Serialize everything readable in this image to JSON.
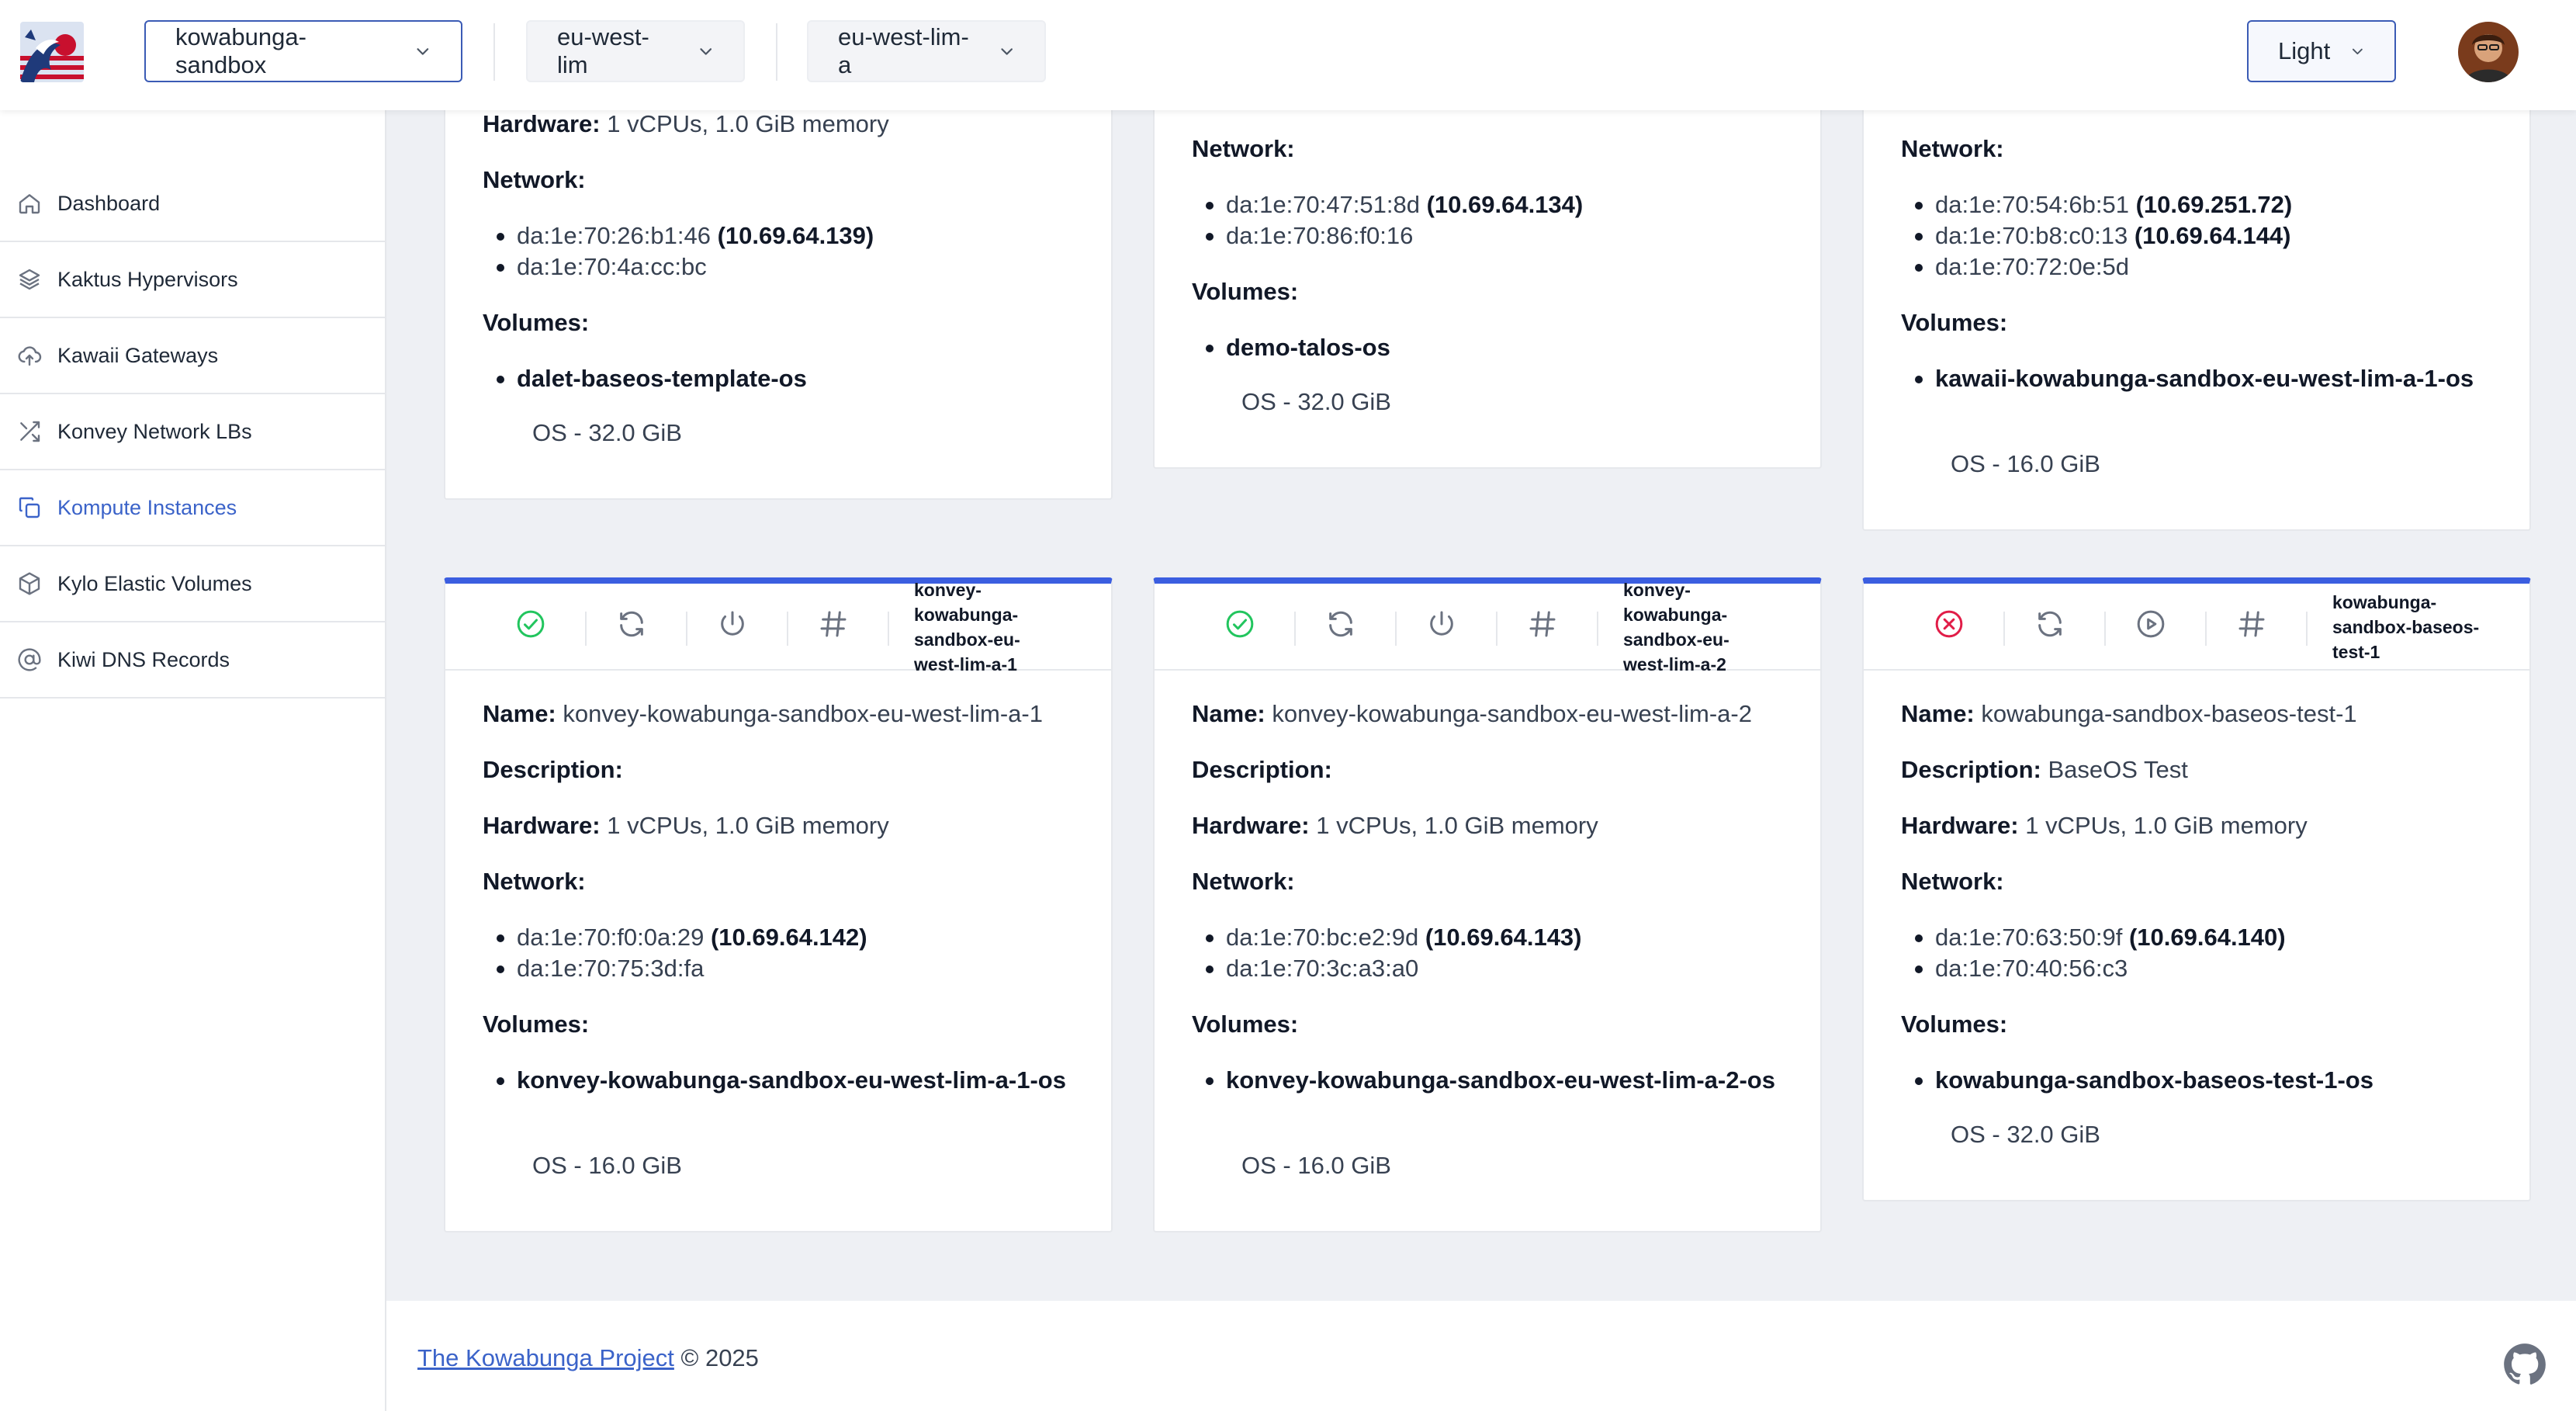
{
  "header": {
    "cloud": "kowabunga-sandbox",
    "region": "eu-west-lim",
    "zone": "eu-west-lim-a",
    "theme": "Light"
  },
  "sidebar": {
    "items": [
      {
        "label": "Dashboard",
        "icon": "home-icon"
      },
      {
        "label": "Kaktus Hypervisors",
        "icon": "layers-icon"
      },
      {
        "label": "Kawaii Gateways",
        "icon": "cloud-upload-icon"
      },
      {
        "label": "Konvey Network LBs",
        "icon": "shuffle-icon"
      },
      {
        "label": "Kompute Instances",
        "icon": "copy-icon"
      },
      {
        "label": "Kylo Elastic Volumes",
        "icon": "cube-icon"
      },
      {
        "label": "Kiwi DNS Records",
        "icon": "at-icon"
      }
    ],
    "active": "Kompute Instances"
  },
  "labels": {
    "name": "Name:",
    "description": "Description:",
    "hardware": "Hardware:",
    "network": "Network:",
    "volumes": "Volumes:"
  },
  "top_cards": [
    {
      "hardware": "1 vCPUs, 1.0 GiB memory",
      "nics": [
        {
          "mac": "da:1e:70:26:b1:46",
          "ip": "(10.69.64.139)"
        },
        {
          "mac": "da:1e:70:4a:cc:bc",
          "ip": ""
        }
      ],
      "volume": "dalet-baseos-template-os",
      "volume_size": "OS - 32.0 GiB"
    },
    {
      "nics": [
        {
          "mac": "da:1e:70:47:51:8d",
          "ip": "(10.69.64.134)"
        },
        {
          "mac": "da:1e:70:86:f0:16",
          "ip": ""
        }
      ],
      "volume": "demo-talos-os",
      "volume_size": "OS - 32.0 GiB"
    },
    {
      "nics": [
        {
          "mac": "da:1e:70:54:6b:51",
          "ip": "(10.69.251.72)"
        },
        {
          "mac": "da:1e:70:b8:c0:13",
          "ip": "(10.69.64.144)"
        },
        {
          "mac": "da:1e:70:72:0e:5d",
          "ip": ""
        }
      ],
      "volume": "kawaii-kowabunga-sandbox-eu-west-lim-a-1-os",
      "volume_size": "OS - 16.0 GiB"
    }
  ],
  "cards": [
    {
      "status": "running",
      "short_name": "konvey-kowabunga-sandbox-eu-west-lim-a-1",
      "name": "konvey-kowabunga-sandbox-eu-west-lim-a-1",
      "description": "",
      "hardware": "1 vCPUs, 1.0 GiB memory",
      "nics": [
        {
          "mac": "da:1e:70:f0:0a:29",
          "ip": "(10.69.64.142)"
        },
        {
          "mac": "da:1e:70:75:3d:fa",
          "ip": ""
        }
      ],
      "volume": "konvey-kowabunga-sandbox-eu-west-lim-a-1-os",
      "volume_size": "OS - 16.0 GiB"
    },
    {
      "status": "running",
      "short_name": "konvey-kowabunga-sandbox-eu-west-lim-a-2",
      "name": "konvey-kowabunga-sandbox-eu-west-lim-a-2",
      "description": "",
      "hardware": "1 vCPUs, 1.0 GiB memory",
      "nics": [
        {
          "mac": "da:1e:70:bc:e2:9d",
          "ip": "(10.69.64.143)"
        },
        {
          "mac": "da:1e:70:3c:a3:a0",
          "ip": ""
        }
      ],
      "volume": "konvey-kowabunga-sandbox-eu-west-lim-a-2-os",
      "volume_size": "OS - 16.0 GiB"
    },
    {
      "status": "stopped",
      "short_name": "kowabunga-sandbox-baseos-test-1",
      "name": "kowabunga-sandbox-baseos-test-1",
      "description": "BaseOS Test",
      "hardware": "1 vCPUs, 1.0 GiB memory",
      "nics": [
        {
          "mac": "da:1e:70:63:50:9f",
          "ip": "(10.69.64.140)"
        },
        {
          "mac": "da:1e:70:40:56:c3",
          "ip": ""
        }
      ],
      "volume": "kowabunga-sandbox-baseos-test-1-os",
      "volume_size": "OS - 32.0 GiB"
    }
  ],
  "footer": {
    "project_link": "The Kowabunga Project",
    "copyright": "© 2025"
  },
  "colors": {
    "accent": "#3b5ee0",
    "running": "#22c55e",
    "stopped": "#e11d48"
  }
}
